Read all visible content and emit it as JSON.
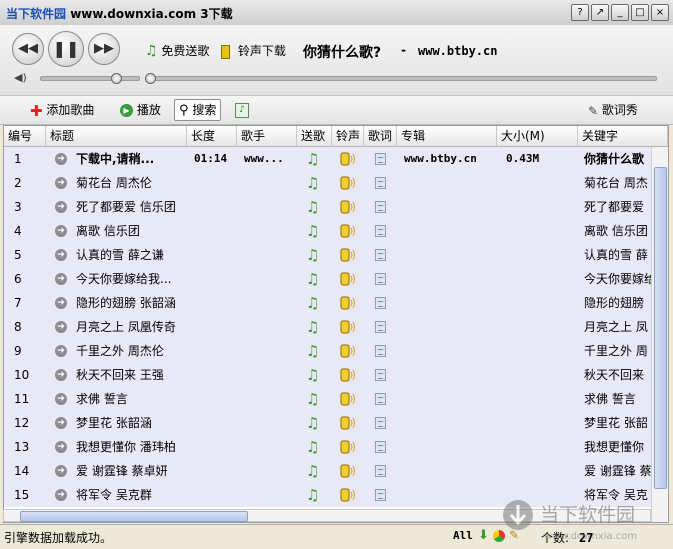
{
  "window": {
    "title_site": "当下软件园",
    "title_url": "www.downxia.com",
    "title_tail": "3下载",
    "buttons": [
      "?",
      "↗",
      "_",
      "□",
      "×"
    ]
  },
  "player": {
    "free_send_label": "免费送歌",
    "ringtone_label": "铃声下载",
    "now_title": "你猜什么歌?",
    "now_sep": "-",
    "now_site": "www.btby.cn",
    "volume_level": 0.78,
    "progress_level": 0.0
  },
  "toolbar": {
    "add_label": "添加歌曲",
    "play_label": "播放",
    "search_label": "搜索",
    "lyrics_show_label": "歌词秀"
  },
  "columns": [
    "编号",
    "标题",
    "长度",
    "歌手",
    "送歌",
    "铃声",
    "歌词",
    "专辑",
    "大小(M)",
    "关键字"
  ],
  "rows": [
    {
      "no": "1",
      "title": "下载中,请稍...",
      "length": "01:14",
      "singer": "www...",
      "album": "www.btby.cn",
      "size": "0.43M",
      "keyword": "你猜什么歌"
    },
    {
      "no": "2",
      "title": "菊花台 周杰伦",
      "length": "",
      "singer": "",
      "album": "",
      "size": "",
      "keyword": "菊花台 周杰"
    },
    {
      "no": "3",
      "title": "死了都要爱 信乐团",
      "length": "",
      "singer": "",
      "album": "",
      "size": "",
      "keyword": "死了都要爱"
    },
    {
      "no": "4",
      "title": "离歌 信乐团",
      "length": "",
      "singer": "",
      "album": "",
      "size": "",
      "keyword": "离歌 信乐团"
    },
    {
      "no": "5",
      "title": "认真的雪 薛之谦",
      "length": "",
      "singer": "",
      "album": "",
      "size": "",
      "keyword": "认真的雪 薛"
    },
    {
      "no": "6",
      "title": "今天你要嫁给我...",
      "length": "",
      "singer": "",
      "album": "",
      "size": "",
      "keyword": "今天你要嫁给"
    },
    {
      "no": "7",
      "title": "隐形的翅膀 张韶涵",
      "length": "",
      "singer": "",
      "album": "",
      "size": "",
      "keyword": "隐形的翅膀"
    },
    {
      "no": "8",
      "title": "月亮之上 凤凰传奇",
      "length": "",
      "singer": "",
      "album": "",
      "size": "",
      "keyword": "月亮之上 凤"
    },
    {
      "no": "9",
      "title": "千里之外 周杰伦",
      "length": "",
      "singer": "",
      "album": "",
      "size": "",
      "keyword": "千里之外 周"
    },
    {
      "no": "10",
      "title": "秋天不回来 王强",
      "length": "",
      "singer": "",
      "album": "",
      "size": "",
      "keyword": "秋天不回来"
    },
    {
      "no": "11",
      "title": "求佛 誓言",
      "length": "",
      "singer": "",
      "album": "",
      "size": "",
      "keyword": "求佛 誓言"
    },
    {
      "no": "12",
      "title": "梦里花 张韶涵",
      "length": "",
      "singer": "",
      "album": "",
      "size": "",
      "keyword": "梦里花 张韶"
    },
    {
      "no": "13",
      "title": "我想更懂你 潘玮柏",
      "length": "",
      "singer": "",
      "album": "",
      "size": "",
      "keyword": "我想更懂你"
    },
    {
      "no": "14",
      "title": "爱 谢霆锋 蔡卓妍",
      "length": "",
      "singer": "",
      "album": "",
      "size": "",
      "keyword": "爱 谢霆锋 蔡"
    },
    {
      "no": "15",
      "title": "将军令 吴克群",
      "length": "",
      "singer": "",
      "album": "",
      "size": "",
      "keyword": "将军令 吴克"
    }
  ],
  "status": {
    "message": "引擎数据加载成功。",
    "filter": "All",
    "count_label": "个数:",
    "count": "27"
  },
  "watermark": {
    "brand": "当下软件园",
    "url": "www.downxia.com"
  },
  "colors": {
    "row_bg": "#e8e8f7",
    "title_blue": "#1a4fb5",
    "note_green": "#2e9c1c"
  }
}
